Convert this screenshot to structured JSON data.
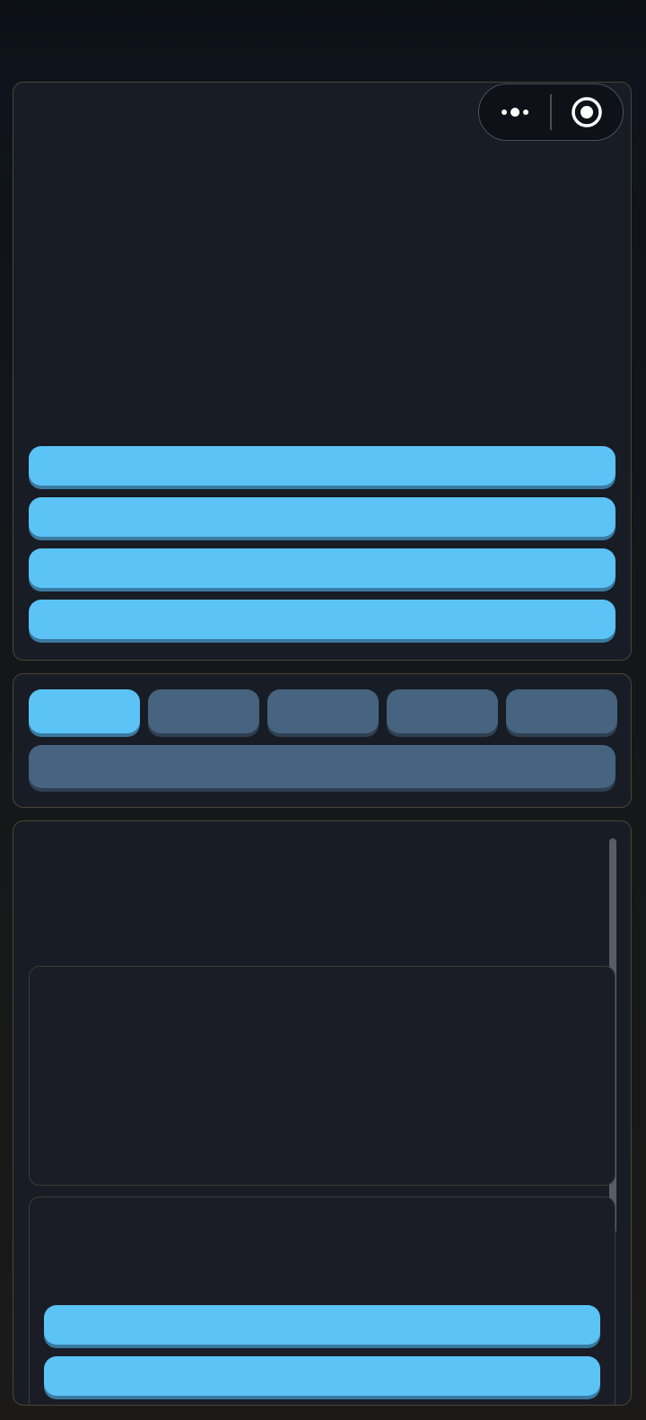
{
  "capsule": {
    "more_icon": "more-dots-icon",
    "close_icon": "target-circle-icon"
  },
  "top_panel": {
    "actions": [
      {
        "label": ""
      },
      {
        "label": ""
      },
      {
        "label": ""
      },
      {
        "label": ""
      }
    ]
  },
  "tabs": {
    "items": [
      {
        "label": "",
        "active": true
      },
      {
        "label": "",
        "active": false
      },
      {
        "label": "",
        "active": false
      },
      {
        "label": "",
        "active": false
      },
      {
        "label": "",
        "active": false
      }
    ],
    "wide_button": {
      "label": ""
    }
  },
  "bottom_panel": {
    "box_2_actions": [
      {
        "label": ""
      },
      {
        "label": ""
      }
    ]
  },
  "colors": {
    "primary": "#5bc3f6",
    "muted": "#46637f",
    "panel_bg": "#181c25",
    "panel_border": "#4a4634"
  }
}
